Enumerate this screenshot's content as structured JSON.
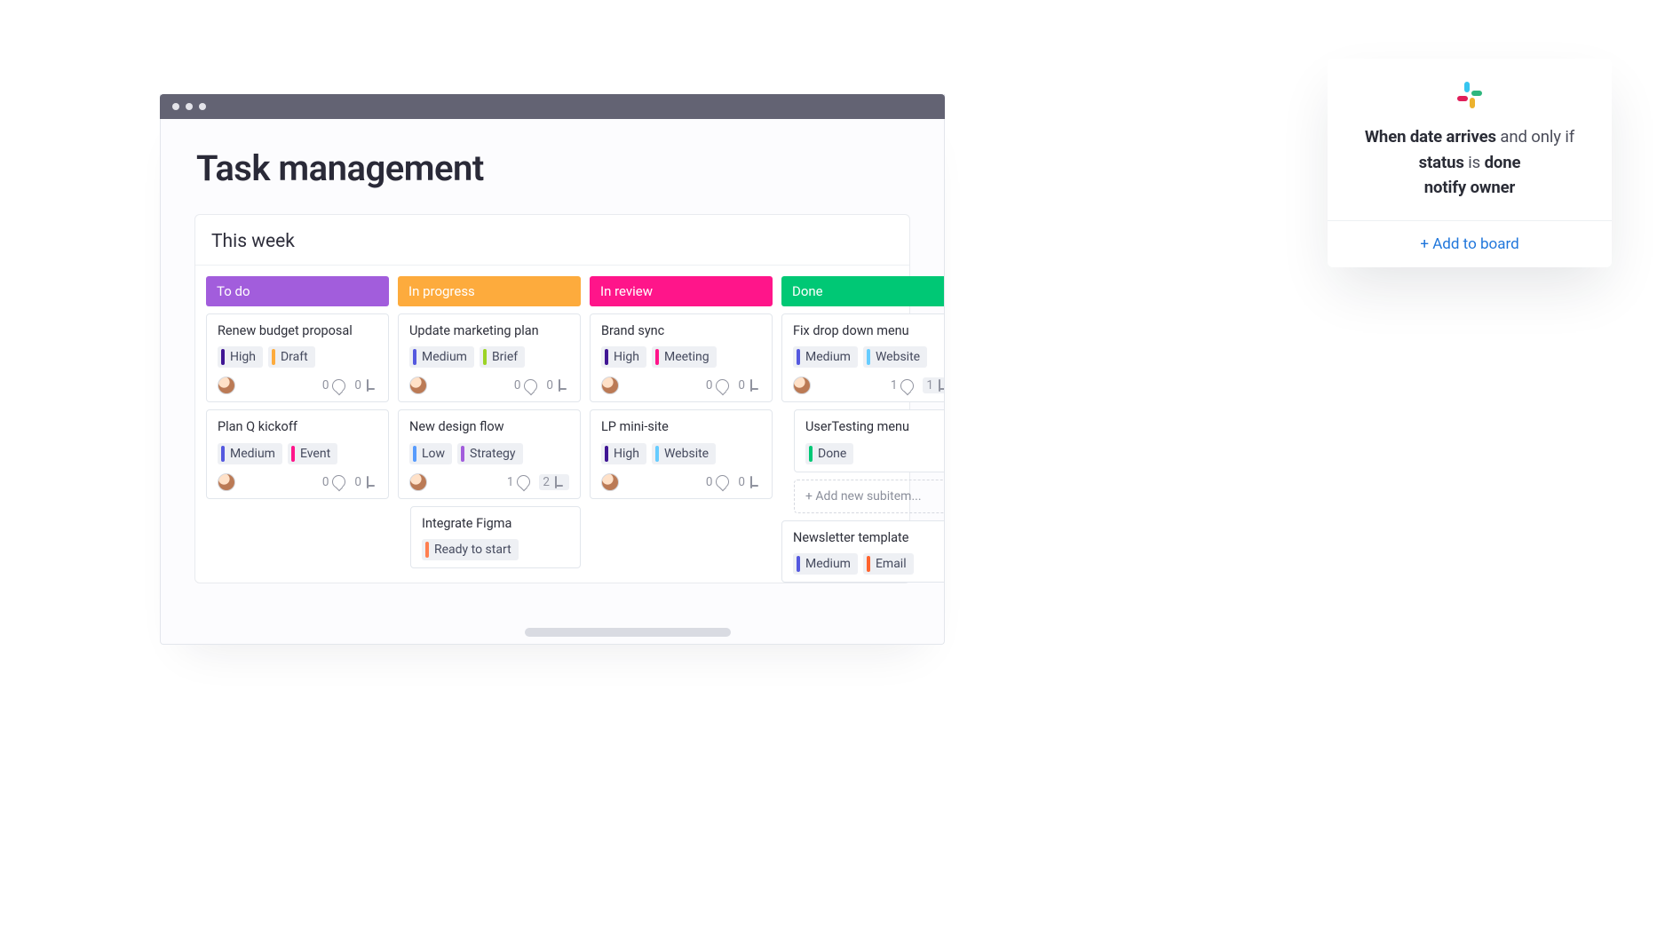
{
  "page": {
    "title": "Task management"
  },
  "group": {
    "title": "This  week"
  },
  "columns": [
    {
      "name": "To do",
      "colorClass": "c-purple"
    },
    {
      "name": "In progress",
      "colorClass": "c-orange"
    },
    {
      "name": "In review",
      "colorClass": "c-pink"
    },
    {
      "name": "Done",
      "colorClass": "c-green"
    }
  ],
  "tagColors": {
    "high": "#401694",
    "medium": "#5559df",
    "low": "#579bfc",
    "draft": "#fdab3d",
    "brief": "#9cd326",
    "meeting": "#ff158a",
    "event": "#ff158a",
    "strategy": "#a25ddc",
    "website": "#66ccff",
    "ready": "#ff7f50",
    "done": "#00c875",
    "email": "#ff642e"
  },
  "cards": {
    "todo": [
      {
        "title": "Renew budget proposal",
        "tags": [
          [
            "High",
            "high"
          ],
          [
            "Draft",
            "draft"
          ]
        ],
        "comments": 0,
        "subs": 0
      },
      {
        "title": "Plan Q kickoff",
        "tags": [
          [
            "Medium",
            "medium"
          ],
          [
            "Event",
            "event"
          ]
        ],
        "comments": 0,
        "subs": 0
      }
    ],
    "inprogress": [
      {
        "title": "Update marketing plan",
        "tags": [
          [
            "Medium",
            "medium"
          ],
          [
            "Brief",
            "brief"
          ]
        ],
        "comments": 0,
        "subs": 0
      },
      {
        "title": "New design flow",
        "tags": [
          [
            "Low",
            "low"
          ],
          [
            "Strategy",
            "strategy"
          ]
        ],
        "comments": 1,
        "subs": 2,
        "subsHighlight": true,
        "children": [
          {
            "title": "Integrate Figma",
            "tags": [
              [
                "Ready to start",
                "ready"
              ]
            ]
          }
        ]
      }
    ],
    "inreview": [
      {
        "title": "Brand sync",
        "tags": [
          [
            "High",
            "high"
          ],
          [
            "Meeting",
            "meeting"
          ]
        ],
        "comments": 0,
        "subs": 0
      },
      {
        "title": "LP mini-site",
        "tags": [
          [
            "High",
            "high"
          ],
          [
            "Website",
            "website"
          ]
        ],
        "comments": 0,
        "subs": 0
      }
    ],
    "done": [
      {
        "title": "Fix drop down menu",
        "tags": [
          [
            "Medium",
            "medium"
          ],
          [
            "Website",
            "website"
          ]
        ],
        "comments": 1,
        "subs": 1,
        "subsHighlight": true,
        "children": [
          {
            "title": "UserTesting menu",
            "tags": [
              [
                "Done",
                "done"
              ]
            ]
          }
        ],
        "addSub": "+ Add new subitem..."
      },
      {
        "title": "Newsletter template",
        "tags": [
          [
            "Medium",
            "medium"
          ],
          [
            "Email",
            "email"
          ]
        ]
      }
    ]
  },
  "automation": {
    "line1_a": "When date arrives",
    "line1_b": " and only if ",
    "line2_a": "status",
    "line2_b": " is ",
    "line2_c": "done",
    "line3": "notify owner",
    "cta": "+ Add to board"
  }
}
